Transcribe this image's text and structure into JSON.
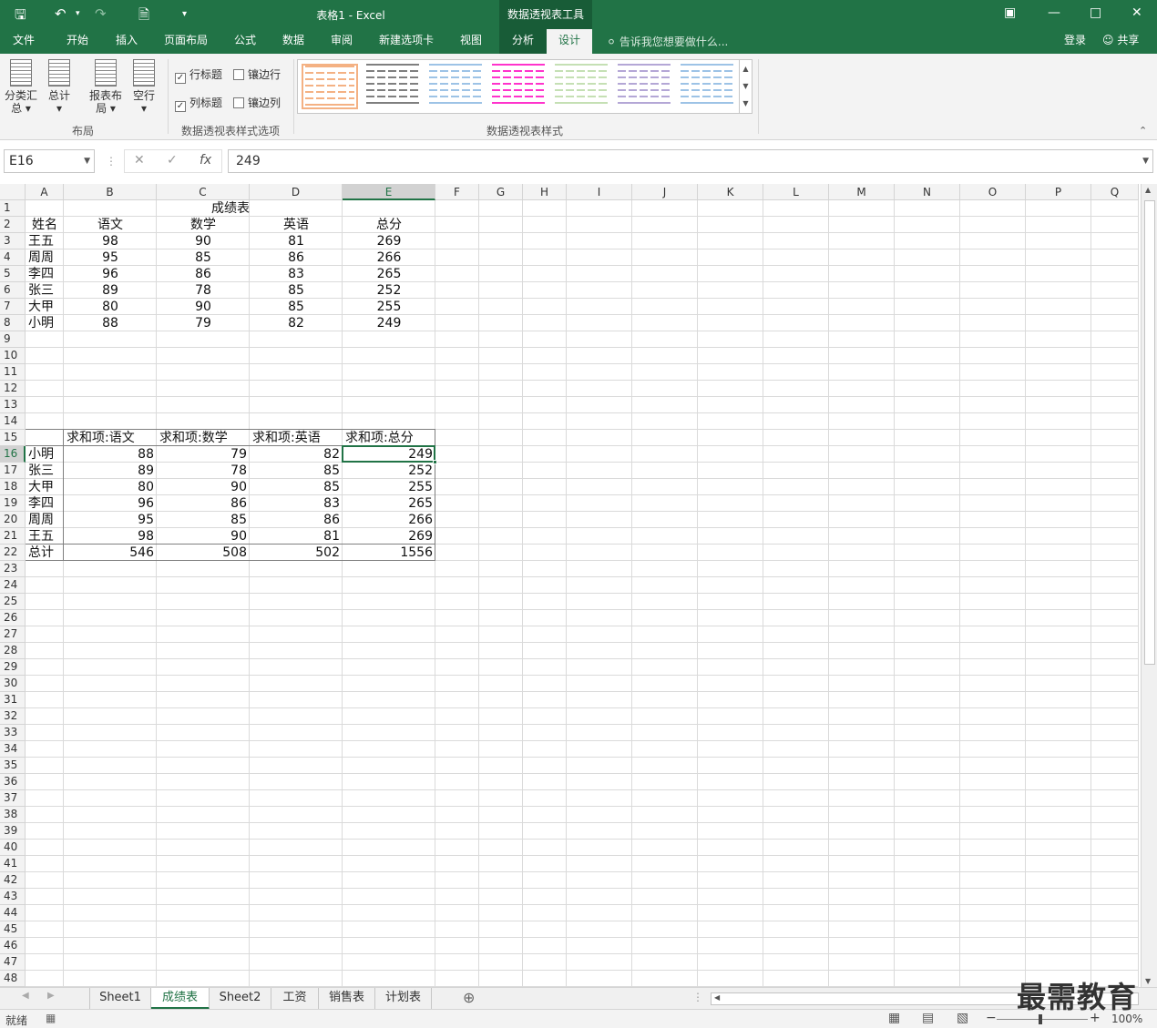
{
  "window": {
    "title": "表格1 - Excel",
    "context_tools": "数据透视表工具",
    "qa_icons": [
      "save-icon",
      "undo-icon",
      "redo-icon",
      "new-file-icon",
      "customize-icon"
    ]
  },
  "tabs": [
    "文件",
    "开始",
    "插入",
    "页面布局",
    "公式",
    "数据",
    "审阅",
    "新建选项卡",
    "视图",
    "分析",
    "设计"
  ],
  "active_tab": "设计",
  "tell_me": "告诉我您想要做什么...",
  "account": {
    "login": "登录",
    "share": "共享"
  },
  "ribbon": {
    "layout_buttons": [
      "分类汇总",
      "总计",
      "报表布局",
      "空行"
    ],
    "layout_group": "布局",
    "options": {
      "row_headers": "行标题",
      "banded_rows": "镶边行",
      "col_headers": "列标题",
      "banded_cols": "镶边列"
    },
    "options_group": "数据透视表样式选项",
    "styles_group": "数据透视表样式",
    "style_colors": [
      "#f4b183",
      "#7f7f7f",
      "#9dc3e6",
      "#ff33cc",
      "#c5e0b4",
      "#b4a7d6",
      "#9dc3e6"
    ]
  },
  "formula": {
    "name_box": "E16",
    "fx": "fx",
    "value": "249"
  },
  "columns": [
    "A",
    "B",
    "C",
    "D",
    "E",
    "F",
    "G",
    "H",
    "I",
    "J",
    "K",
    "L",
    "M",
    "N",
    "O",
    "P",
    "Q"
  ],
  "selected_column": "E",
  "selected_row": "16",
  "table": {
    "title": "成绩表",
    "headers": [
      "姓名",
      "语文",
      "数学",
      "英语",
      "总分"
    ],
    "rows": [
      [
        "王五",
        "98",
        "90",
        "81",
        "269"
      ],
      [
        "周周",
        "95",
        "85",
        "86",
        "266"
      ],
      [
        "李四",
        "96",
        "86",
        "83",
        "265"
      ],
      [
        "张三",
        "89",
        "78",
        "85",
        "252"
      ],
      [
        "大甲",
        "80",
        "90",
        "85",
        "255"
      ],
      [
        "小明",
        "88",
        "79",
        "82",
        "249"
      ]
    ]
  },
  "pivot": {
    "headers": [
      "求和项:语文",
      "求和项:数学",
      "求和项:英语",
      "求和项:总分"
    ],
    "rows": [
      [
        "小明",
        "88",
        "79",
        "82",
        "249"
      ],
      [
        "张三",
        "89",
        "78",
        "85",
        "252"
      ],
      [
        "大甲",
        "80",
        "90",
        "85",
        "255"
      ],
      [
        "李四",
        "96",
        "86",
        "83",
        "265"
      ],
      [
        "周周",
        "95",
        "85",
        "86",
        "266"
      ],
      [
        "王五",
        "98",
        "90",
        "81",
        "269"
      ]
    ],
    "total": [
      "总计",
      "546",
      "508",
      "502",
      "1556"
    ]
  },
  "sheets": [
    "Sheet1",
    "成绩表",
    "Sheet2",
    "工资",
    "销售表",
    "计划表"
  ],
  "active_sheet": "成绩表",
  "status": {
    "ready": "就绪",
    "zoom": "100%"
  },
  "watermark": "最需教育"
}
